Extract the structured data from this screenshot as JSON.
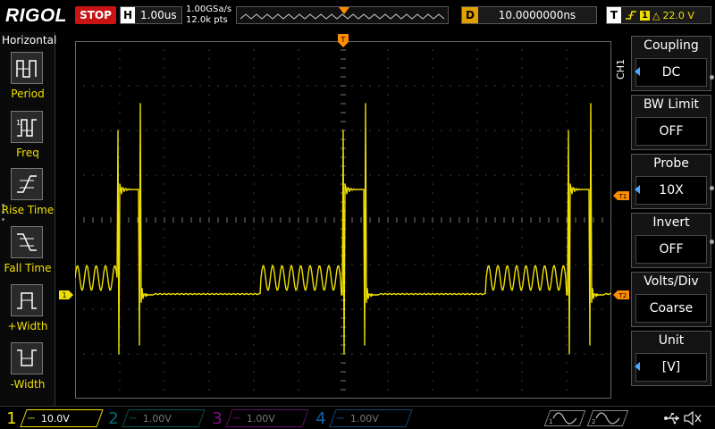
{
  "topbar": {
    "logo": "RIGOL",
    "run_state": "STOP",
    "horizontal_key": "H",
    "timebase": "1.00us",
    "sample_rate": "1.00GSa/s",
    "memory_depth": "12.0k pts",
    "trigger_marker": "T",
    "delay_key": "D",
    "delay": "10.0000000ns",
    "trigger_key": "T",
    "trigger_source": "1",
    "trigger_level": "22.0 V"
  },
  "left_menu": {
    "title": "Horizontal",
    "items": [
      {
        "label": "Period",
        "icon": "period-icon"
      },
      {
        "label": "Freq",
        "icon": "freq-icon"
      },
      {
        "label": "Rise Time",
        "icon": "rise-time-icon"
      },
      {
        "label": "Fall Time",
        "icon": "fall-time-icon"
      },
      {
        "label": "+Width",
        "icon": "positive-width-icon"
      },
      {
        "label": "-Width",
        "icon": "negative-width-icon"
      }
    ]
  },
  "markers": {
    "ch1": "1",
    "t1": "T1",
    "t2": "T2",
    "trigger": "T"
  },
  "right_menu": {
    "channel": "CH1",
    "items": [
      {
        "label": "Coupling",
        "value": "DC",
        "arrow": true
      },
      {
        "label": "BW Limit",
        "value": "OFF",
        "arrow": false
      },
      {
        "label": "Probe",
        "value": "10X",
        "arrow": true
      },
      {
        "label": "Invert",
        "value": "OFF",
        "arrow": false
      },
      {
        "label": "Volts/Div",
        "value": "Coarse",
        "arrow": false
      },
      {
        "label": "Unit",
        "value": "[V]",
        "arrow": true
      }
    ]
  },
  "channels": [
    {
      "num": "1",
      "scale": "10.0V",
      "color": "#f0e000",
      "active": true
    },
    {
      "num": "2",
      "scale": "1.00V",
      "color": "#00b0b0",
      "active": false
    },
    {
      "num": "3",
      "scale": "1.00V",
      "color": "#c020c0",
      "active": false
    },
    {
      "num": "4",
      "scale": "1.00V",
      "color": "#2080e0",
      "active": false
    }
  ],
  "colors": {
    "ch1": "#f0e000",
    "trigger": "#ff8c00",
    "grid": "#3a3a3a",
    "accent_blue": "#4aa8ff"
  }
}
